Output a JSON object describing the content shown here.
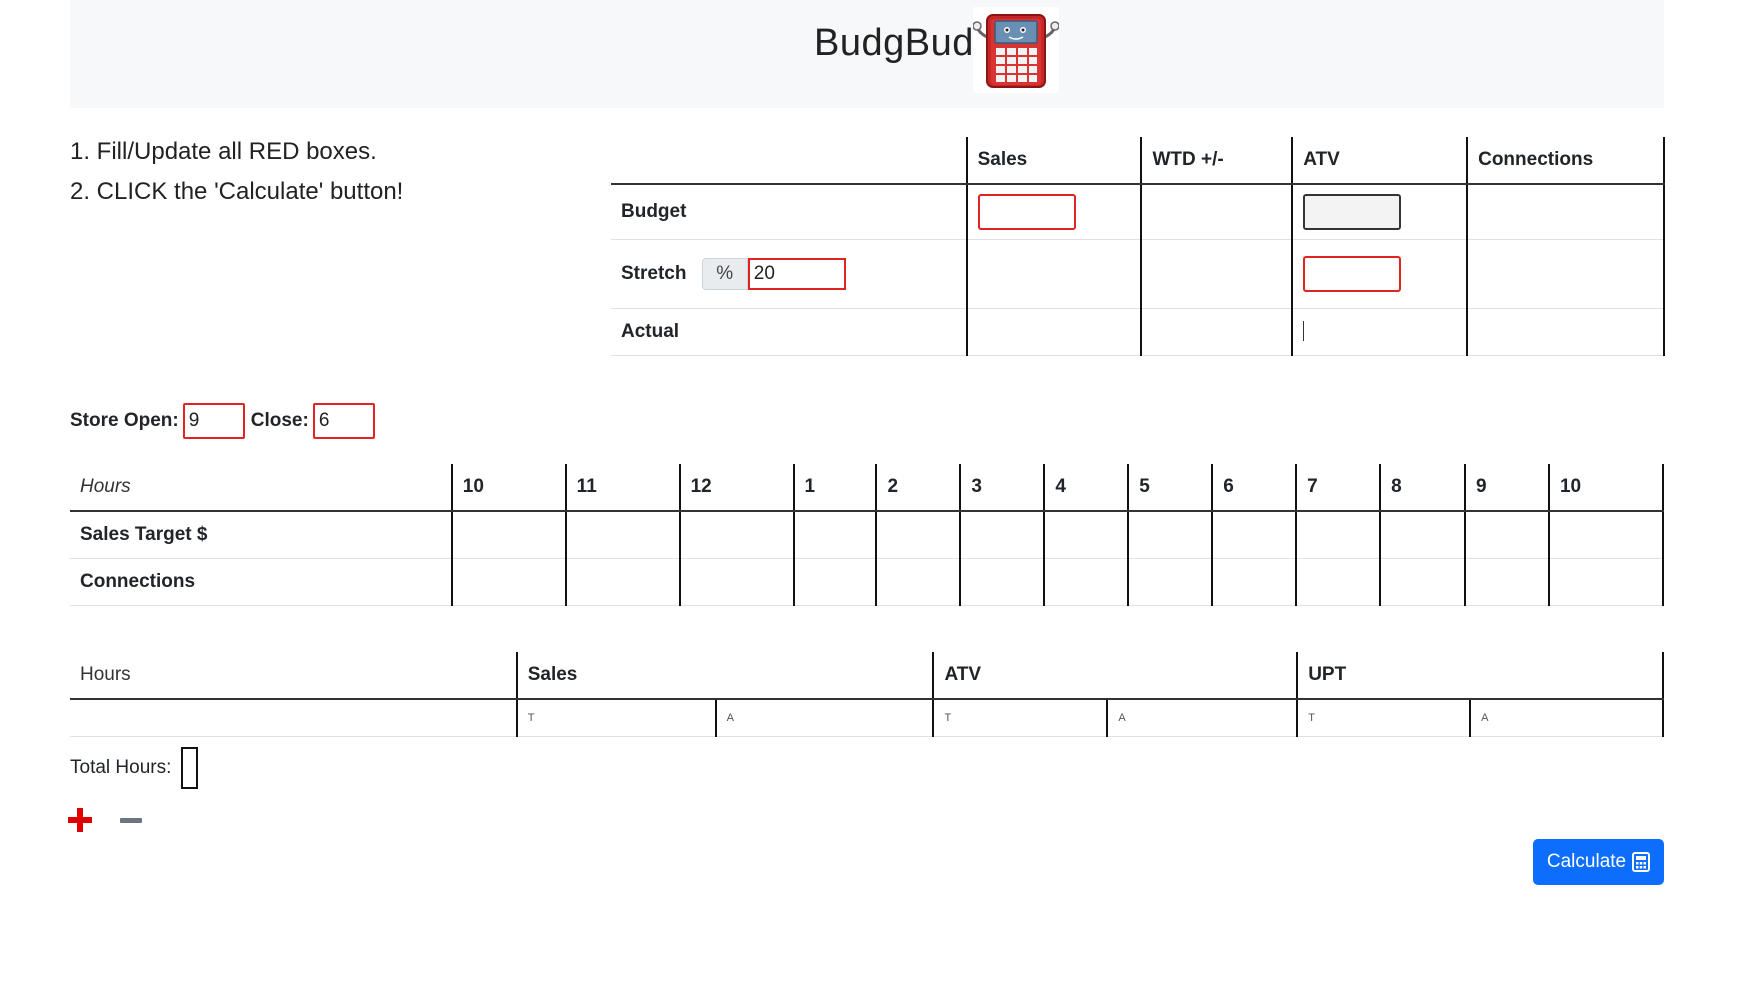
{
  "header": {
    "title": "BudgBud",
    "logo_icon": "calculator-mascot-icon",
    "background": "#f7f8f9"
  },
  "instructions": {
    "step1": "1. Fill/Update all RED boxes.",
    "step2": "2. CLICK the 'Calculate' button!"
  },
  "budget_table": {
    "columns": [
      "",
      "Sales",
      "WTD +/-",
      "ATV",
      "Connections"
    ],
    "rows": {
      "budget": "Budget",
      "stretch": "Stretch",
      "actual": "Actual"
    },
    "stretch_prefix": "%",
    "stretch_value": "20",
    "sales_budget_value": "",
    "atv_budget_value": "",
    "atv_stretch_value": ""
  },
  "store_hours": {
    "open_label": "Store Open:",
    "open_value": "9",
    "close_label": "Close:",
    "close_value": "6"
  },
  "hours_table": {
    "first_header": "Hours",
    "hours": [
      "10",
      "11",
      "12",
      "1",
      "2",
      "3",
      "4",
      "5",
      "6",
      "7",
      "8",
      "9",
      "10"
    ],
    "rows": [
      "Sales Target $",
      "Connections"
    ]
  },
  "staff_table": {
    "first_header": "Hours",
    "groups": [
      "Sales",
      "ATV",
      "UPT"
    ],
    "sub_t": "T",
    "sub_a": "A"
  },
  "total_hours": {
    "label": "Total Hours:",
    "value": ""
  },
  "actions": {
    "add_icon": "plus-icon",
    "remove_icon": "minus-icon",
    "calculate_label": "Calculate",
    "calculate_icon": "calculator-icon"
  },
  "colors": {
    "required_border": "#e02424",
    "primary": "#0d6efd",
    "add": "#e00000",
    "remove": "#6c757d"
  }
}
